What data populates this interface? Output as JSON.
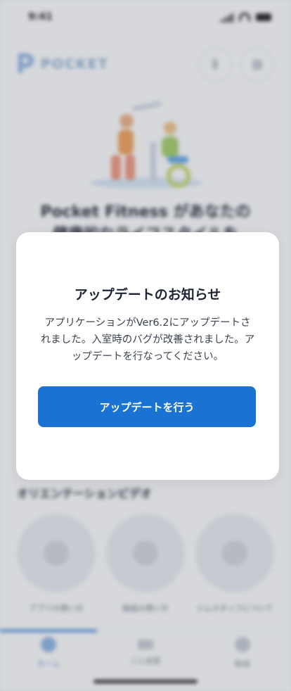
{
  "status_bar": {
    "time": "9:41"
  },
  "header": {
    "logo_text": "POCKET"
  },
  "hero": {
    "title_line1": "Pocket Fitness があなたの",
    "title_line2": "健康的なライフスタイルを"
  },
  "orientation": {
    "title": "オリエンテーションビデオ",
    "videos": [
      {
        "label": "アプリの使い方"
      },
      {
        "label": "施設の使い方"
      },
      {
        "label": "ジムスタッフについて"
      }
    ]
  },
  "tab_bar": {
    "tabs": [
      {
        "label": "ホーム",
        "active": true
      },
      {
        "label": "ジム探索",
        "active": false
      },
      {
        "label": "動画",
        "active": false
      }
    ]
  },
  "modal": {
    "title": "アップデートのお知らせ",
    "body": "アプリケーションがVer6.2にアップデートされました。入室時のバグが改善されました。アップデートを行なってください。",
    "button_label": "アップデートを行う"
  },
  "colors": {
    "accent": "#1a73d2",
    "overlay": "#464e5c"
  }
}
